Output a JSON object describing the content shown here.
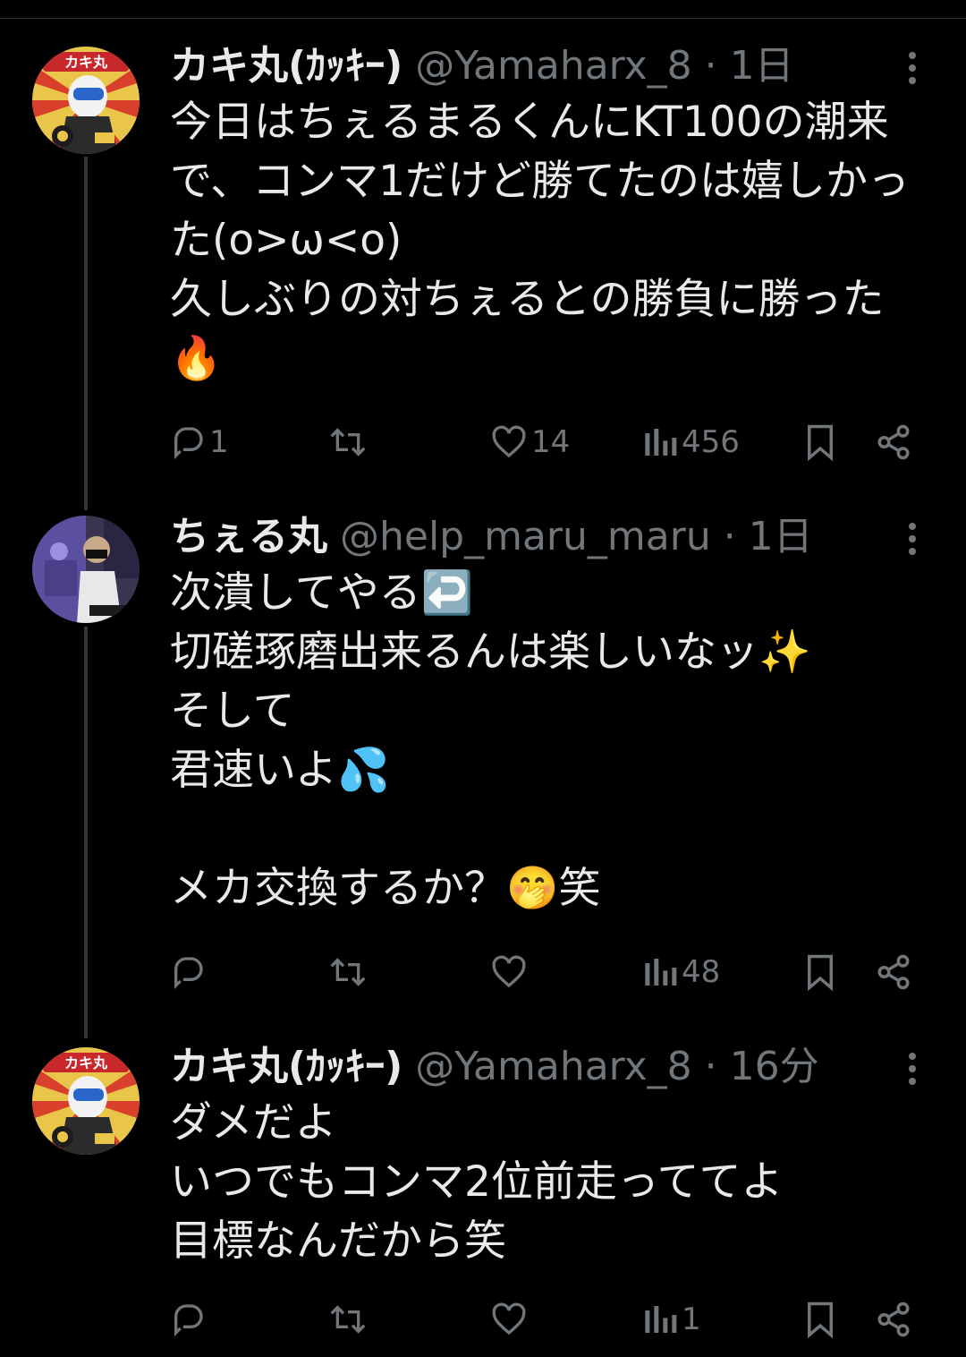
{
  "tweets": [
    {
      "name": "カキ丸(ｶｯｷｰ)",
      "handle": "@Yamaharx_8",
      "dot": "·",
      "time": "1日",
      "text": "今日はちぇるまるくんにKT100の潮来で、コンマ1だけど勝てたのは嬉しかった(o>ω<o)\n久しぶりの対ちぇるとの勝負に勝った🔥",
      "replies": "1",
      "retweets": "",
      "likes": "14",
      "views": "456"
    },
    {
      "name": "ちぇる丸",
      "handle": "@help_maru_maru",
      "dot": "·",
      "time": "1日",
      "text": "次潰してやる↩️\n切磋琢磨出来るんは楽しいなッ✨\nそして\n君速いよ💦\n\nメカ交換するか？🤭笑",
      "replies": "",
      "retweets": "",
      "likes": "",
      "views": "48"
    },
    {
      "name": "カキ丸(ｶｯｷｰ)",
      "handle": "@Yamaharx_8",
      "dot": "·",
      "time": "16分",
      "text": "ダメだよ\nいつでもコンマ2位前走っててよ\n目標なんだから笑",
      "replies": "",
      "retweets": "",
      "likes": "",
      "views": "1"
    }
  ],
  "avatar_badge": "カキ丸",
  "colors": {
    "background": "#000000",
    "text": "#e7e9ea",
    "muted": "#71767b",
    "thread_line": "#333639"
  },
  "icons": [
    "reply-icon",
    "retweet-icon",
    "like-icon",
    "views-icon",
    "bookmark-icon",
    "share-icon",
    "more-icon"
  ]
}
